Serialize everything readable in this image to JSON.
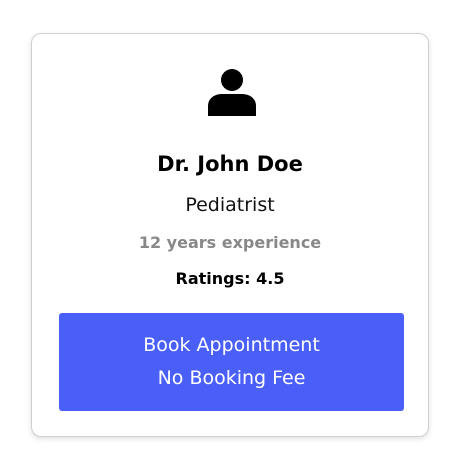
{
  "doctor": {
    "name": "Dr. John Doe",
    "specialty": "Pediatrist",
    "experience": "12 years experience",
    "ratings": "Ratings: 4.5",
    "avatar_icon": "user-icon"
  },
  "booking": {
    "line1": "Book Appointment",
    "line2": "No Booking Fee",
    "color": "#4a5ff8"
  }
}
